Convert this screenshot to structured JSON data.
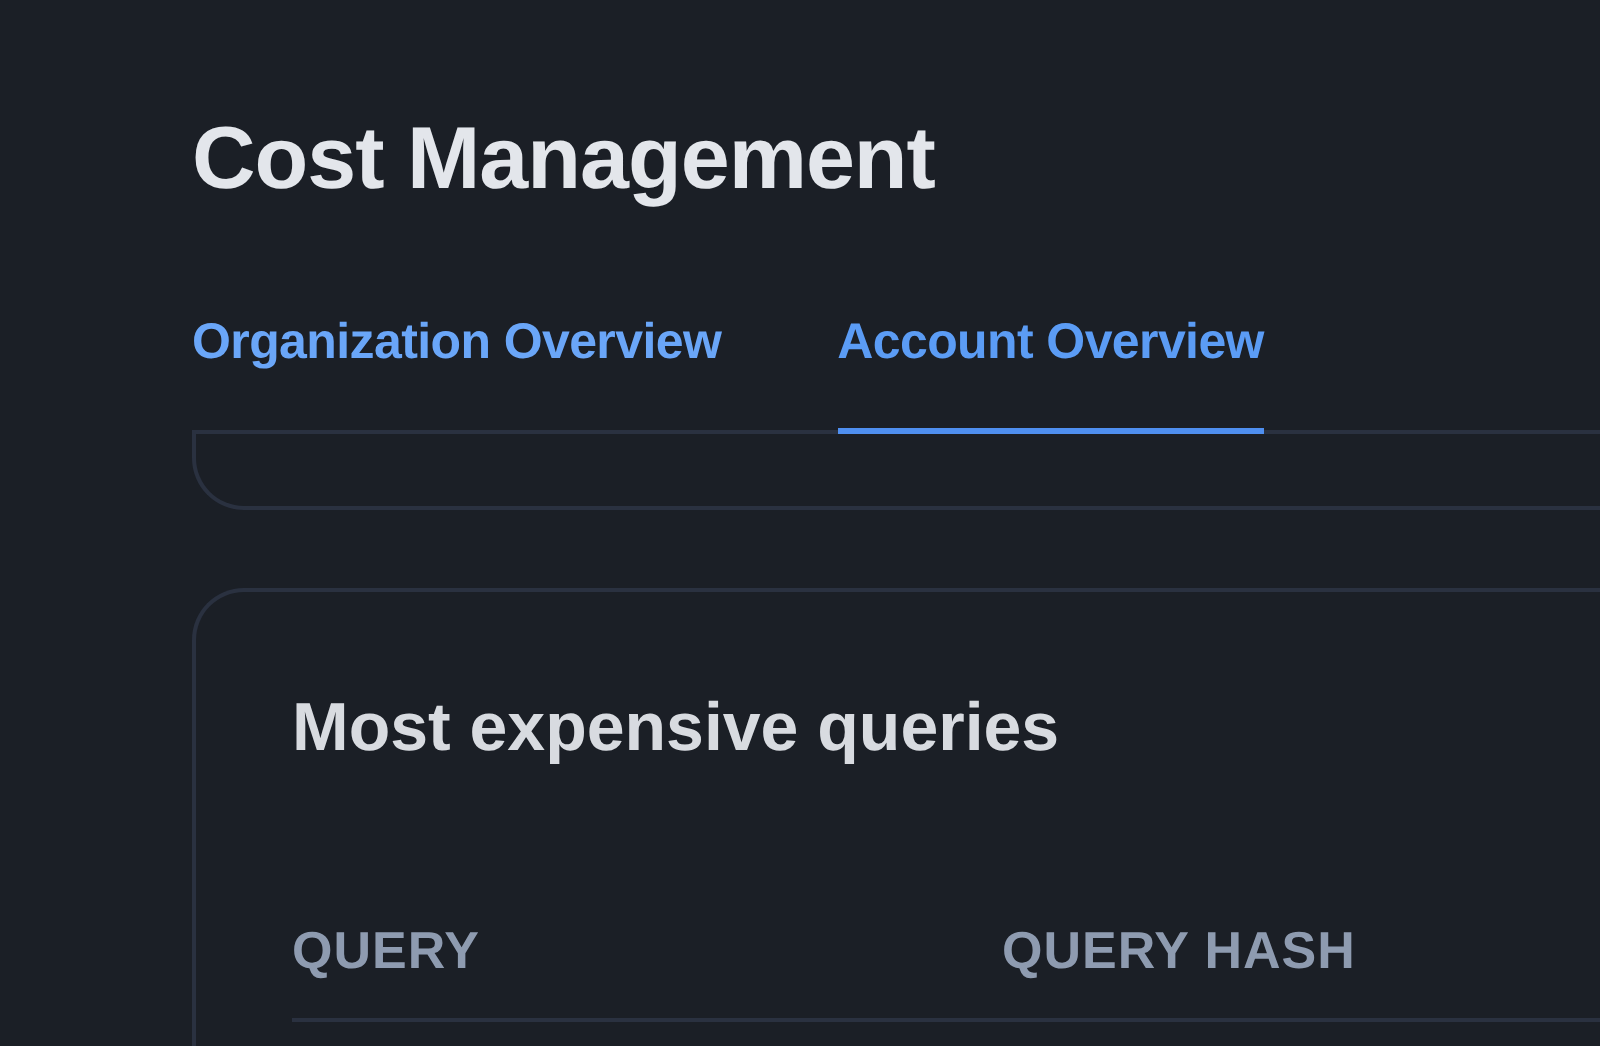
{
  "page_title": "Cost Management",
  "tabs": [
    {
      "label": "Organization Overview",
      "selected": false
    },
    {
      "label": "Account Overview",
      "selected": true
    }
  ],
  "section": {
    "title": "Most expensive queries",
    "table": {
      "columns": [
        "QUERY",
        "QUERY HASH"
      ]
    }
  }
}
